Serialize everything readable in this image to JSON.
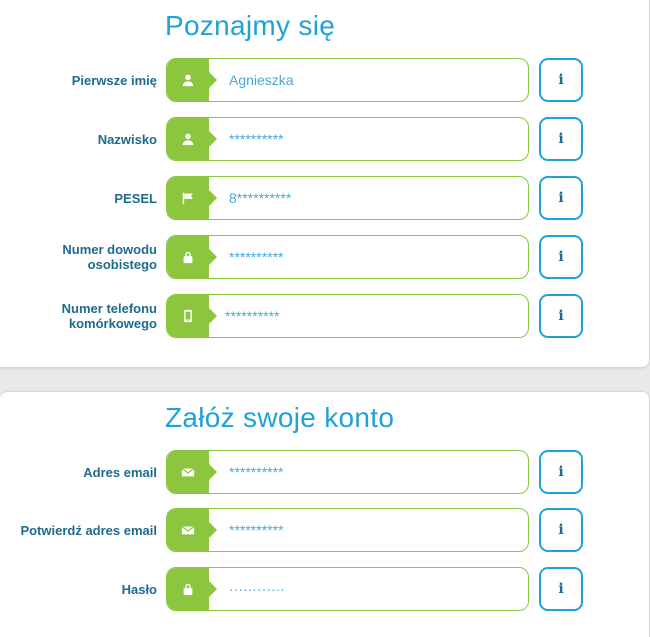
{
  "colors": {
    "accent_green": "#8cc63e",
    "accent_blue": "#1fa2d8",
    "label_blue": "#1e6b8c"
  },
  "section1": {
    "title": "Poznajmy się",
    "rows": [
      {
        "label": "Pierwsze imię",
        "icon": "user-icon",
        "value": "Agnieszka",
        "info": "i"
      },
      {
        "label": "Nazwisko",
        "icon": "user-icon",
        "value": "**********",
        "info": "i"
      },
      {
        "label": "PESEL",
        "icon": "flag-icon",
        "value": "8**********",
        "info": "i"
      },
      {
        "label": "Numer dowodu osobistego",
        "icon": "lock-icon",
        "value": "**********",
        "info": "i"
      },
      {
        "label": "Numer telefonu komórkowego",
        "icon": "mobile-icon",
        "value": "**********",
        "info": "i"
      }
    ]
  },
  "section2": {
    "title": "Załóż swoje konto",
    "rows": [
      {
        "label": "Adres email",
        "icon": "envelope-icon",
        "value": "**********",
        "info": "i"
      },
      {
        "label": "Potwierdź adres email",
        "icon": "envelope-icon",
        "value": "**********",
        "info": "i"
      },
      {
        "label": "Hasło",
        "icon": "lock-icon",
        "value": "············",
        "info": "i"
      }
    ]
  }
}
